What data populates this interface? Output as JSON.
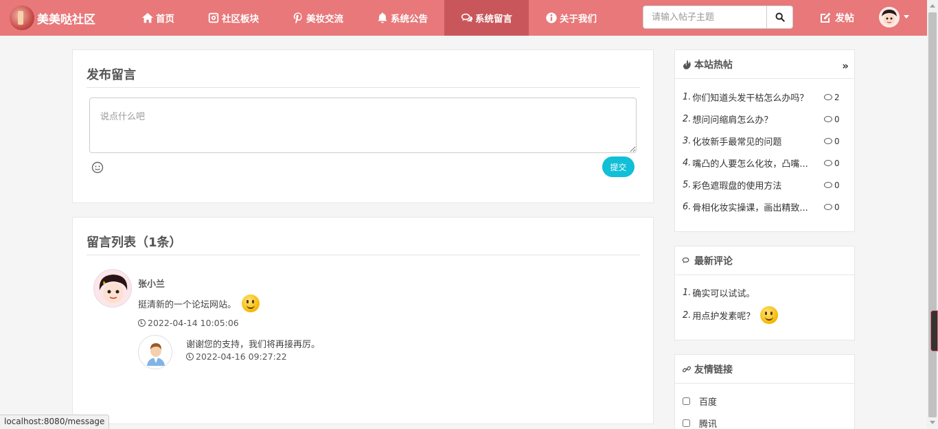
{
  "brand": {
    "name": "美美哒社区"
  },
  "nav": [
    {
      "label": "首页",
      "icon": "home-icon"
    },
    {
      "label": "社区板块",
      "icon": "instagram-icon"
    },
    {
      "label": "美妆交流",
      "icon": "pinterest-icon"
    },
    {
      "label": "系统公告",
      "icon": "bell-icon"
    },
    {
      "label": "系统留言",
      "icon": "comments-icon",
      "active": true
    },
    {
      "label": "关于我们",
      "icon": "info-icon"
    }
  ],
  "search": {
    "placeholder": "请输入帖子主题"
  },
  "header": {
    "post_label": "发帖"
  },
  "publish": {
    "title": "发布留言",
    "placeholder": "说点什么吧",
    "submit_label": "提交"
  },
  "messages": {
    "title": "留言列表（1条）",
    "items": [
      {
        "author": "张小兰",
        "text": "挺清新的一个论坛网站。",
        "time": "2022-04-14 10:05:06",
        "reply": {
          "text": "谢谢您的支持，我们将再接再厉。",
          "time": "2022-04-16 09:27:22"
        }
      }
    ]
  },
  "hot_posts": {
    "title": "本站热帖",
    "items": [
      {
        "index": "1.",
        "title": "你们知道头发干枯怎么办吗？",
        "count": "2"
      },
      {
        "index": "2.",
        "title": "想问问缩肩怎么办？",
        "count": "0"
      },
      {
        "index": "3.",
        "title": "化妆新手最常见的问题",
        "count": "0"
      },
      {
        "index": "4.",
        "title": "嘴凸的人要怎么化妆，凸嘴...",
        "count": "0"
      },
      {
        "index": "5.",
        "title": "彩色遮瑕盘的使用方法",
        "count": "0"
      },
      {
        "index": "6.",
        "title": "骨相化妆实操课，画出精致...",
        "count": "0"
      }
    ]
  },
  "latest_comments": {
    "title": "最新评论",
    "items": [
      {
        "index": "1.",
        "text": "确实可以试试。"
      },
      {
        "index": "2.",
        "text": "用点护发素呢？"
      }
    ]
  },
  "friend_links": {
    "title": "友情链接",
    "items": [
      {
        "label": "百度"
      },
      {
        "label": "腾讯"
      }
    ]
  },
  "status_url": "localhost:8080/message",
  "colors": {
    "navbar": "#e8787a",
    "nav_active": "#c9565a",
    "submit": "#11bfd6"
  }
}
